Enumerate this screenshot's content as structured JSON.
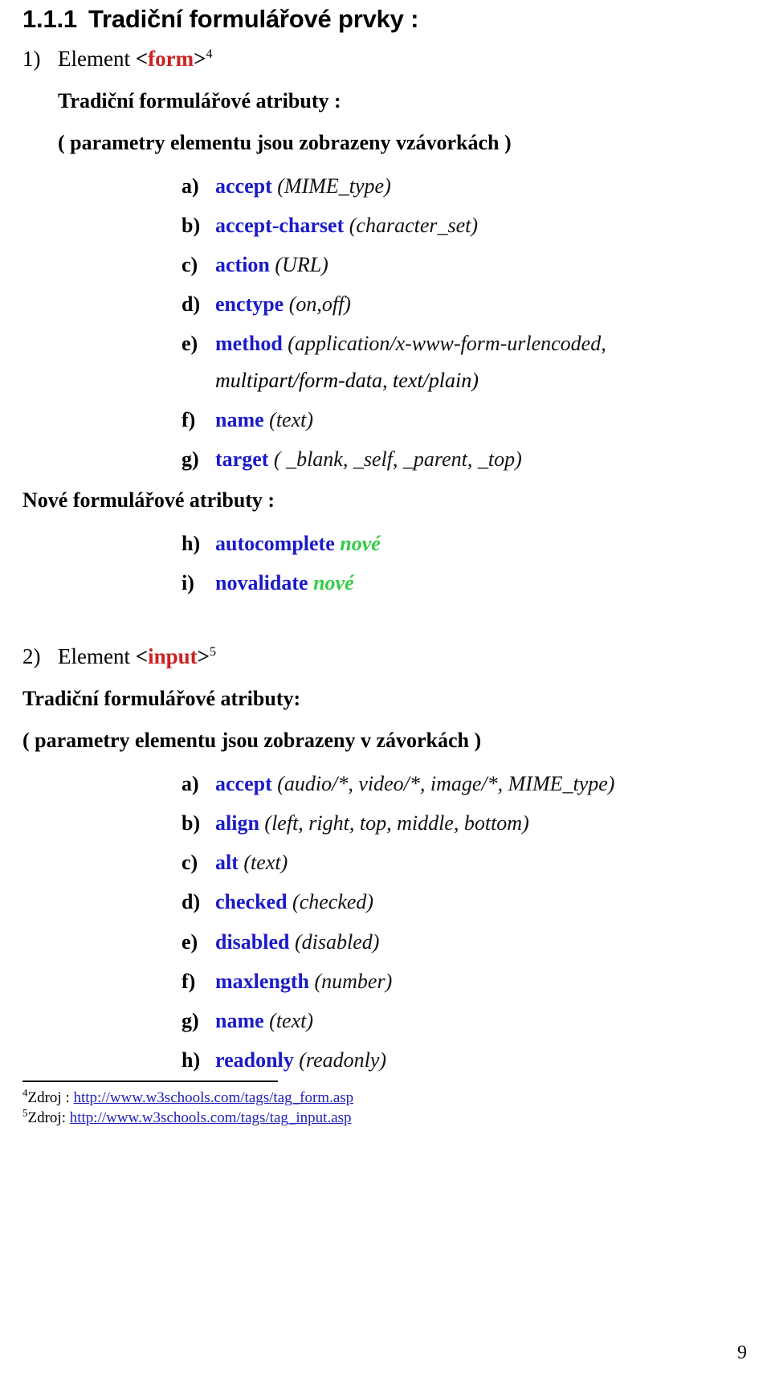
{
  "heading": {
    "number": "1.1.1",
    "title": "Tradiční formulářové prvky :"
  },
  "sections": [
    {
      "marker": "1)",
      "element_prefix": "Element ",
      "tag_open": "<",
      "tag_name": "form",
      "tag_close": ">",
      "footnote_ref": "4",
      "sub_heading": "Tradiční formulářové atributy :",
      "paren_note": "( parametry elementu jsou zobrazeny vzávorkách )",
      "attrs": [
        {
          "letter": "a)",
          "name": "accept",
          "params": "(MIME_type)"
        },
        {
          "letter": "b)",
          "name": "accept-charset",
          "params": "(character_set)"
        },
        {
          "letter": "c)",
          "name": "action",
          "params": "(URL)"
        },
        {
          "letter": "d)",
          "name": "enctype",
          "params": "(on,off)"
        },
        {
          "letter": "e)",
          "name": "method",
          "params": "(application/x-www-form-urlencoded,",
          "params_cont": "multipart/form-data, text/plain)"
        },
        {
          "letter": "f)",
          "name": "name",
          "params": "(text)"
        },
        {
          "letter": "g)",
          "name": "target",
          "params": "( _blank, _self, _parent, _top)"
        }
      ],
      "new_heading": "Nové formulářové atributy :",
      "new_attrs": [
        {
          "letter": "h)",
          "name": "autocomplete",
          "badge": "nové"
        },
        {
          "letter": "i)",
          "name": "novalidate",
          "badge": "nové"
        }
      ]
    },
    {
      "marker": "2)",
      "element_prefix": "Element ",
      "tag_open": "<",
      "tag_name": "input",
      "tag_close": ">",
      "footnote_ref": "5",
      "sub_heading": "Tradiční formulářové atributy:",
      "paren_note": "( parametry elementu jsou zobrazeny v závorkách )",
      "attrs": [
        {
          "letter": "a)",
          "name": "accept",
          "params": "(audio/*, video/*, image/*, MIME_type)"
        },
        {
          "letter": "b)",
          "name": "align",
          "params": "(left, right, top, middle, bottom)"
        },
        {
          "letter": "c)",
          "name": "alt",
          "params": "(text)"
        },
        {
          "letter": "d)",
          "name": "checked",
          "params": "(checked)"
        },
        {
          "letter": "e)",
          "name": "disabled",
          "params": "(disabled)"
        },
        {
          "letter": "f)",
          "name": "maxlength",
          "params": "(number)"
        },
        {
          "letter": "g)",
          "name": "name",
          "params": "(text)"
        },
        {
          "letter": "h)",
          "name": "readonly",
          "params": "(readonly)"
        }
      ]
    }
  ],
  "footnotes": [
    {
      "ref": "4",
      "label": "Zdroj : ",
      "url": "http://www.w3schools.com/tags/tag_form.asp"
    },
    {
      "ref": "5",
      "label": "Zdroj: ",
      "url": "http://www.w3schools.com/tags/tag_input.asp"
    }
  ],
  "page_number": "9",
  "colors": {
    "tag_red": "#cc2222",
    "attr_blue": "#1a1ac8",
    "new_green": "#33cc44",
    "link_blue": "#2222bb"
  }
}
